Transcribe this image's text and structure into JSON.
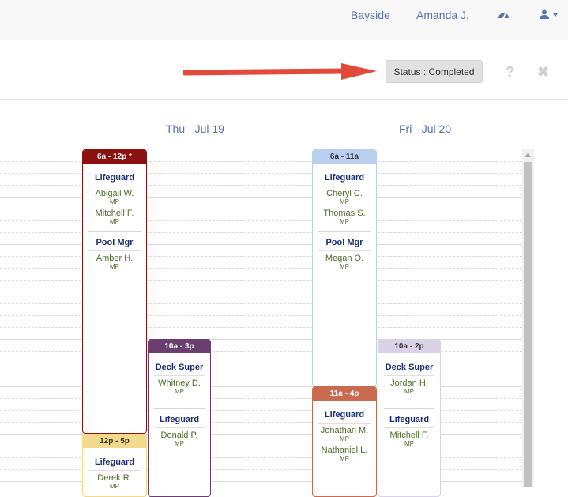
{
  "topbar": {
    "location": "Bayside",
    "user": "Amanda J.",
    "dashboard_icon": "dashboard-icon",
    "user_icon": "user-icon"
  },
  "toolbar": {
    "status_label": "Status : Completed",
    "help_label": "?",
    "close_label": "✖"
  },
  "days": [
    {
      "label": "Thu - Jul 19"
    },
    {
      "label": "Fri - Jul 20"
    }
  ],
  "colors": {
    "maroon": "#8b1111",
    "blue_light": "#b8cff0",
    "purple": "#6a3e6e",
    "orange": "#c96a50",
    "lavender": "#dcd2e8",
    "yellow": "#f2d98b",
    "arrow": "#e24a3c"
  },
  "shifts": [
    {
      "time": "6a - 12p  *",
      "roles": [
        {
          "role": "Lifeguard",
          "employees": [
            {
              "name": "Abigail W.",
              "tag": "MP"
            },
            {
              "name": "Mitchell F.",
              "tag": "MP"
            }
          ]
        },
        {
          "role": "Pool Mgr",
          "employees": [
            {
              "name": "Amber H.",
              "tag": "MP"
            }
          ]
        }
      ]
    },
    {
      "time": "12p - 5p",
      "roles": [
        {
          "role": "Lifeguard",
          "employees": [
            {
              "name": "Derek R.",
              "tag": "MP"
            }
          ]
        }
      ]
    },
    {
      "time": "10a - 3p",
      "roles": [
        {
          "role": "Deck Super",
          "employees": [
            {
              "name": "Whitney D.",
              "tag": "MP"
            }
          ]
        },
        {
          "role": "Lifeguard",
          "employees": [
            {
              "name": "Donald P.",
              "tag": "MP"
            }
          ]
        }
      ]
    },
    {
      "time": "6a - 11a",
      "roles": [
        {
          "role": "Lifeguard",
          "employees": [
            {
              "name": "Cheryl C.",
              "tag": "MP"
            },
            {
              "name": "Thomas S.",
              "tag": "MP"
            }
          ]
        },
        {
          "role": "Pool Mgr",
          "employees": [
            {
              "name": "Megan O.",
              "tag": "MP"
            }
          ]
        }
      ]
    },
    {
      "time": "11a - 4p",
      "roles": [
        {
          "role": "Lifeguard",
          "employees": [
            {
              "name": "Jonathan M.",
              "tag": "MP"
            },
            {
              "name": "Nathaniel L.",
              "tag": "MP"
            }
          ]
        }
      ]
    },
    {
      "time": "10a - 2p",
      "roles": [
        {
          "role": "Deck Super",
          "employees": [
            {
              "name": "Jordan H.",
              "tag": "MP"
            }
          ]
        },
        {
          "role": "Lifeguard",
          "employees": [
            {
              "name": "Mitchell F.",
              "tag": "MP"
            }
          ]
        }
      ]
    }
  ]
}
